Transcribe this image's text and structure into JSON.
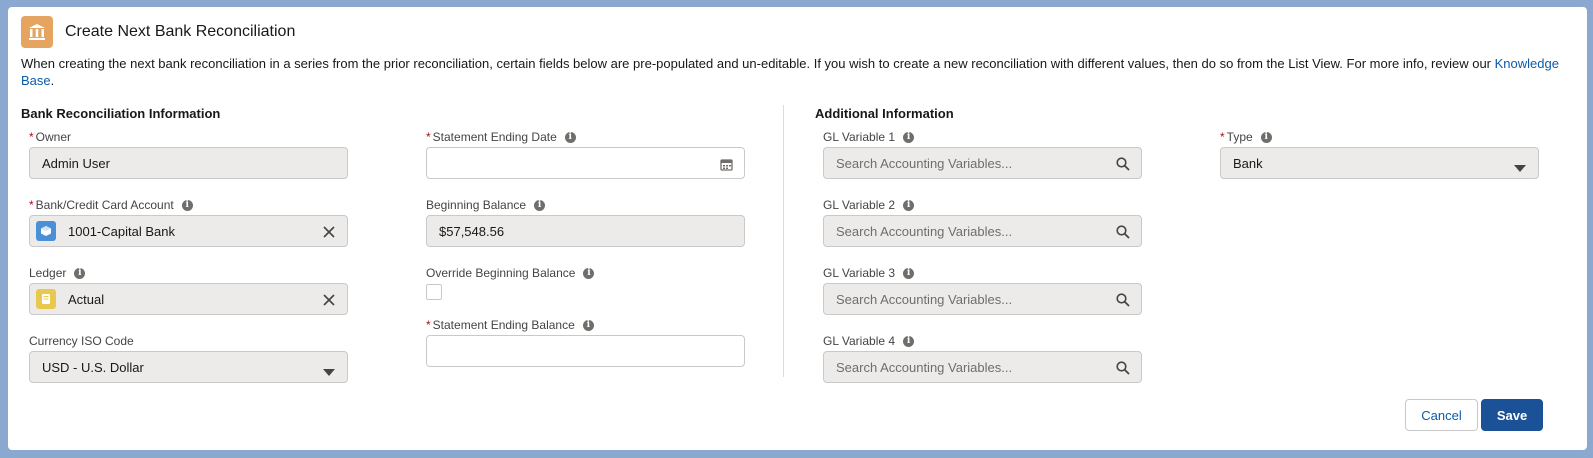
{
  "header": {
    "title": "Create Next Bank Reconciliation",
    "icon": "bank-icon"
  },
  "intro": {
    "text": "When creating the next bank reconciliation in a series from the prior reconciliation, certain fields below are pre-populated and un-editable. If you wish to create a new reconciliation with different values, then do so from the List View. For more info, review our ",
    "link": "Knowledge Base",
    "after": "."
  },
  "sections": {
    "bank_info": "Bank Reconciliation Information",
    "additional": "Additional Information"
  },
  "fields": {
    "owner": {
      "label": "Owner",
      "required": "*",
      "value": "Admin User"
    },
    "bank_account": {
      "label": "Bank/Credit Card Account",
      "required": "*",
      "value": "1001-Capital Bank"
    },
    "ledger": {
      "label": "Ledger",
      "value": "Actual"
    },
    "currency": {
      "label": "Currency ISO Code",
      "value": "USD - U.S. Dollar"
    },
    "statement_end_date": {
      "label": "Statement Ending Date",
      "required": "*",
      "value": ""
    },
    "beginning_balance": {
      "label": "Beginning Balance",
      "value": "$57,548.56"
    },
    "override_beginning_balance": {
      "label": "Override Beginning Balance",
      "checked": false
    },
    "statement_end_balance": {
      "label": "Statement Ending Balance",
      "required": "*",
      "value": ""
    },
    "gl1": {
      "label": "GL Variable 1",
      "placeholder": "Search Accounting Variables..."
    },
    "gl2": {
      "label": "GL Variable 2",
      "placeholder": "Search Accounting Variables..."
    },
    "gl3": {
      "label": "GL Variable 3",
      "placeholder": "Search Accounting Variables..."
    },
    "gl4": {
      "label": "GL Variable 4",
      "placeholder": "Search Accounting Variables..."
    },
    "type": {
      "label": "Type",
      "required": "*",
      "value": "Bank"
    }
  },
  "info_glyph": "i",
  "buttons": {
    "cancel": "Cancel",
    "save": "Save"
  },
  "colors": {
    "brand": "#1b5297",
    "link": "#0b5cab",
    "header_icon": "#e5a560",
    "bank_badge": "#4a90d9",
    "ledger_badge": "#e8c84f"
  }
}
